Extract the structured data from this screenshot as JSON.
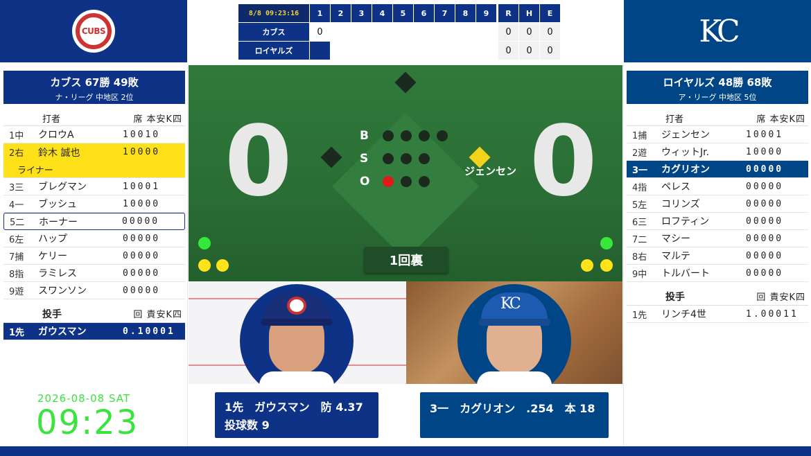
{
  "linescore": {
    "clock": "8/8 09:23:16",
    "innings": [
      "1",
      "2",
      "3",
      "4",
      "5",
      "6",
      "7",
      "8",
      "9"
    ],
    "rhe": [
      "R",
      "H",
      "E"
    ],
    "rows": [
      {
        "team": "カブス",
        "innings": [
          "0",
          "",
          "",
          "",
          "",
          "",
          "",
          "",
          ""
        ],
        "rhe": [
          "0",
          "0",
          "0"
        ]
      },
      {
        "team": "ロイヤルズ",
        "innings": [
          "",
          "",
          "",
          "",
          "",
          "",
          "",
          "",
          ""
        ],
        "rhe": [
          "0",
          "0",
          "0"
        ]
      }
    ]
  },
  "left_team": {
    "title": "カブス 67勝 49敗",
    "league": "ナ・リーグ 中地区 2位",
    "batter_header": "打者",
    "batter_cols": "席 本安K四",
    "batters": [
      {
        "num": "1中",
        "name": "クロウA",
        "stats": "10010"
      },
      {
        "num": "2右",
        "name": "鈴木 誠也",
        "stats": "10000"
      },
      {
        "num": "3三",
        "name": "ブレグマン",
        "stats": "10001"
      },
      {
        "num": "4一",
        "name": "ブッシュ",
        "stats": "10000"
      },
      {
        "num": "5二",
        "name": "ホーナー",
        "stats": "00000"
      },
      {
        "num": "6左",
        "name": "ハップ",
        "stats": "00000"
      },
      {
        "num": "7捕",
        "name": "ケリー",
        "stats": "00000"
      },
      {
        "num": "8指",
        "name": "ラミレス",
        "stats": "00000"
      },
      {
        "num": "9遊",
        "name": "スワンソン",
        "stats": "00000"
      }
    ],
    "last_result": "ライナー",
    "pitcher_header": "投手",
    "pitcher_cols": "回 責安K四",
    "pitcher": {
      "num": "1先",
      "name": "ガウスマン",
      "stats": "0.10001"
    }
  },
  "right_team": {
    "title": "ロイヤルズ 48勝 68敗",
    "league": "ア・リーグ 中地区 5位",
    "batter_header": "打者",
    "batter_cols": "席 本安K四",
    "batters": [
      {
        "num": "1捕",
        "name": "ジェンセン",
        "stats": "10001"
      },
      {
        "num": "2遊",
        "name": "ウィットJr.",
        "stats": "10000"
      },
      {
        "num": "3一",
        "name": "カグリオン",
        "stats": "00000"
      },
      {
        "num": "4指",
        "name": "ペレス",
        "stats": "00000"
      },
      {
        "num": "5左",
        "name": "コリンズ",
        "stats": "00000"
      },
      {
        "num": "6三",
        "name": "ロフティン",
        "stats": "00000"
      },
      {
        "num": "7二",
        "name": "マシー",
        "stats": "00000"
      },
      {
        "num": "8右",
        "name": "マルテ",
        "stats": "00000"
      },
      {
        "num": "9中",
        "name": "トルバート",
        "stats": "00000"
      }
    ],
    "pitcher_header": "投手",
    "pitcher_cols": "回 責安K四",
    "pitcher": {
      "num": "1先",
      "name": "リンチ4世",
      "stats": "1.00011"
    }
  },
  "field": {
    "away_score": "0",
    "home_score": "0",
    "count_labels": [
      "B",
      "S",
      "O"
    ],
    "balls": 0,
    "strikes": 0,
    "outs": 1,
    "runner_on_first": "ジェンセン",
    "inning": "1回裏"
  },
  "pitcher_card": {
    "line1": "1先　ガウスマン　防 4.37",
    "line2": "投球数 9"
  },
  "batter_card": {
    "line1": "3一　カグリオン　.254　本 18"
  },
  "clock": {
    "date": "2026-08-08 SAT",
    "time": "09:23"
  },
  "logos": {
    "left": "CUBS",
    "right": "KC"
  },
  "colors": {
    "cubs_blue": "#0e3386",
    "royals_blue": "#004687",
    "highlight": "#ffe11a",
    "clock_green": "#3be33f"
  }
}
